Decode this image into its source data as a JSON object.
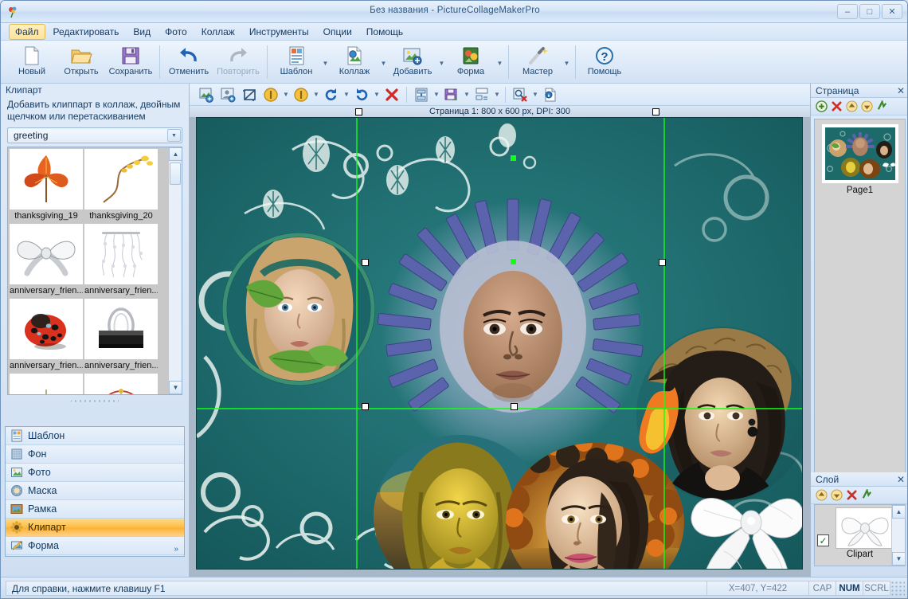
{
  "window": {
    "title": "Без названия - PictureCollageMakerPro",
    "minimize": "–",
    "maximize": "□",
    "close": "✕"
  },
  "menubar": {
    "items": [
      {
        "label": "Файл",
        "active": true
      },
      {
        "label": "Редактировать",
        "active": false
      },
      {
        "label": "Вид",
        "active": false
      },
      {
        "label": "Фото",
        "active": false
      },
      {
        "label": "Коллаж",
        "active": false
      },
      {
        "label": "Инструменты",
        "active": false
      },
      {
        "label": "Опции",
        "active": false
      },
      {
        "label": "Помощь",
        "active": false
      }
    ]
  },
  "toolbar": {
    "buttons": [
      {
        "label": "Новый",
        "icon": "new-page-icon",
        "caret": false,
        "disabled": false
      },
      {
        "label": "Открыть",
        "icon": "folder-open-icon",
        "caret": false,
        "disabled": false
      },
      {
        "label": "Сохранить",
        "icon": "floppy-save-icon",
        "caret": false,
        "disabled": false
      },
      {
        "label": "Отменить",
        "icon": "undo-arrow-icon",
        "caret": false,
        "disabled": false
      },
      {
        "label": "Повторить",
        "icon": "redo-arrow-icon",
        "caret": false,
        "disabled": true
      },
      {
        "label": "Шаблон",
        "icon": "template-icon",
        "caret": true,
        "disabled": false
      },
      {
        "label": "Коллаж",
        "icon": "collage-icon",
        "caret": true,
        "disabled": false
      },
      {
        "label": "Добавить",
        "icon": "add-photo-icon",
        "caret": true,
        "disabled": false
      },
      {
        "label": "Форма",
        "icon": "shape-icon",
        "caret": true,
        "disabled": false
      },
      {
        "label": "Мастер",
        "icon": "wizard-wand-icon",
        "caret": true,
        "disabled": false
      },
      {
        "label": "Помощь",
        "icon": "help-question-icon",
        "caret": false,
        "disabled": false
      }
    ]
  },
  "subtoolbar": {
    "buttons": [
      "add-image-icon",
      "portrait-icon",
      "crop-icon",
      "zoom-in-coin-icon",
      "zoom-out-coin-icon",
      "rotate-right-icon",
      "rotate-left-icon",
      "delete-x-icon",
      "align-vertical-icon",
      "save-as-icon",
      "arrange-icon",
      "preview-icon",
      "info-icon"
    ]
  },
  "left_panel": {
    "title": "Клипарт",
    "description": "Добавить клиппарт в коллаж, двойным щелчком или перетаскиванием",
    "category_value": "greeting",
    "clipart_items": [
      {
        "name": "thanksgiving_19",
        "icon": "autumn-leaves-clipart"
      },
      {
        "name": "thanksgiving_20",
        "icon": "pussy-willow-clipart"
      },
      {
        "name": "anniversary_frien...",
        "icon": "silver-bow-clipart"
      },
      {
        "name": "anniversary_frien...",
        "icon": "beaded-strands-clipart"
      },
      {
        "name": "anniversary_frien...",
        "icon": "ladybug-clipart"
      },
      {
        "name": "anniversary_frien...",
        "icon": "binder-clip-clipart"
      },
      {
        "name": "",
        "icon": "leaf-clipart"
      },
      {
        "name": "",
        "icon": "ferris-wheel-clipart"
      }
    ],
    "categories": [
      {
        "label": "Шаблон",
        "icon": "template-icon",
        "selected": false
      },
      {
        "label": "Фон",
        "icon": "background-icon",
        "selected": false
      },
      {
        "label": "Фото",
        "icon": "photo-icon",
        "selected": false
      },
      {
        "label": "Маска",
        "icon": "mask-icon",
        "selected": false
      },
      {
        "label": "Рамка",
        "icon": "frame-icon",
        "selected": false
      },
      {
        "label": "Клипарт",
        "icon": "clipart-icon",
        "selected": true
      },
      {
        "label": "Форма",
        "icon": "shape-pencil-icon",
        "selected": false
      }
    ],
    "expander": "»"
  },
  "canvas": {
    "ruler_label": "Страница 1: 800 x 600 px, DPI: 300",
    "background_color": "#1d6a6b",
    "guide_color": "#12ff12"
  },
  "right_panel": {
    "page": {
      "title": "Страница",
      "close": "✕",
      "tools": [
        "add-page-icon",
        "delete-page-icon",
        "move-up-icon",
        "move-down-icon",
        "refresh-icon"
      ],
      "pages": [
        {
          "label": "Page1"
        }
      ]
    },
    "layer": {
      "title": "Слой",
      "close": "✕",
      "tools": [
        "move-up-icon",
        "move-down-icon",
        "delete-x-icon",
        "refresh-icon"
      ],
      "layers": [
        {
          "label": "Clipart",
          "visible": true,
          "icon": "white-bow-clipart"
        }
      ]
    }
  },
  "statusbar": {
    "message": "Для справки, нажмите клавишу F1",
    "coordinates": "X=407, Y=422",
    "indicators": [
      {
        "label": "CAP",
        "active": false
      },
      {
        "label": "NUM",
        "active": true
      },
      {
        "label": "SCRL",
        "active": false
      }
    ]
  }
}
